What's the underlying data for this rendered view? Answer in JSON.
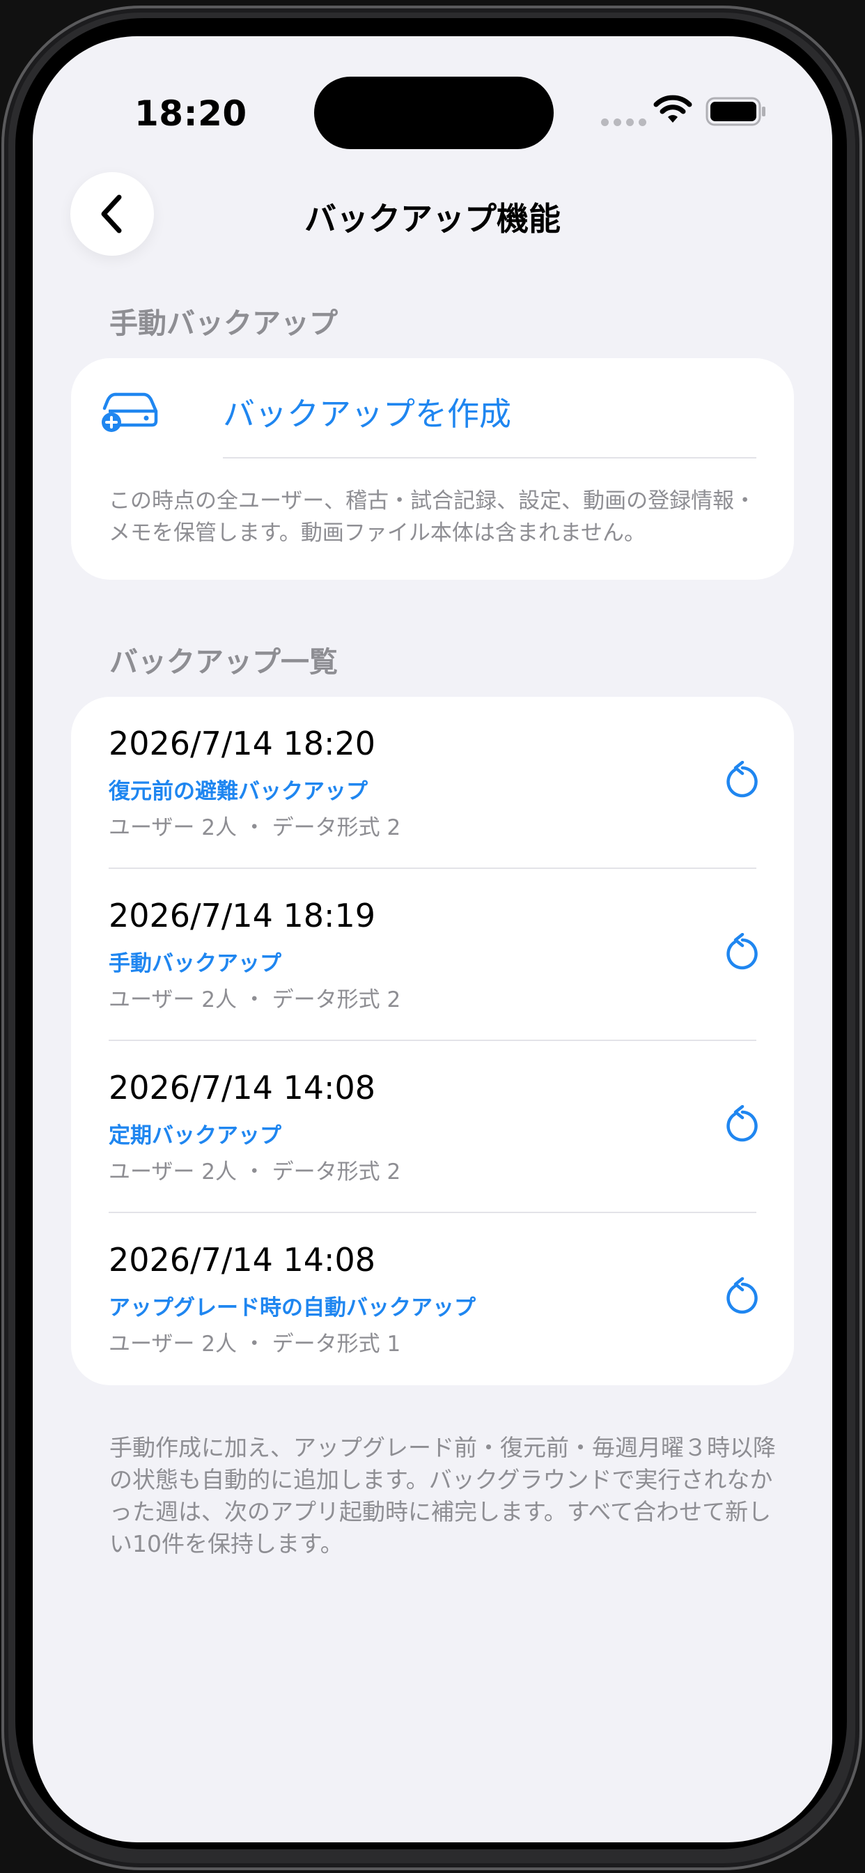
{
  "status_bar": {
    "time": "18:20"
  },
  "nav": {
    "title": "バックアップ機能",
    "back_icon": "chevron-left-icon"
  },
  "manual_section": {
    "header": "手動バックアップ",
    "create_label": "バックアップを作成",
    "create_icon": "drive-plus-icon",
    "description": "この時点の全ユーザー、稽古・試合記録、設定、動画の登録情報・メモを保管します。動画ファイル本体は含まれません。"
  },
  "list_section": {
    "header": "バックアップ一覧",
    "items": [
      {
        "datetime": "2026/7/14 18:20",
        "type": "復元前の避難バックアップ",
        "meta": "ユーザー 2人 ・ データ形式 2",
        "icon": "restore-icon"
      },
      {
        "datetime": "2026/7/14 18:19",
        "type": "手動バックアップ",
        "meta": "ユーザー 2人 ・ データ形式 2",
        "icon": "restore-icon"
      },
      {
        "datetime": "2026/7/14 14:08",
        "type": "定期バックアップ",
        "meta": "ユーザー 2人 ・ データ形式 2",
        "icon": "restore-icon"
      },
      {
        "datetime": "2026/7/14 14:08",
        "type": "アップグレード時の自動バックアップ",
        "meta": "ユーザー 2人 ・ データ形式 1",
        "icon": "restore-icon"
      }
    ],
    "footer": "手動作成に加え、アップグレード前・復元前・毎週月曜３時以降の状態も自動的に追加します。バックグラウンドで実行されなかった週は、次のアプリ起動時に補完します。すべて合わせて新しい10件を保持します。"
  },
  "colors": {
    "accent": "#1f86f0",
    "background": "#f2f2f7",
    "secondary_text": "#8e8e93"
  }
}
